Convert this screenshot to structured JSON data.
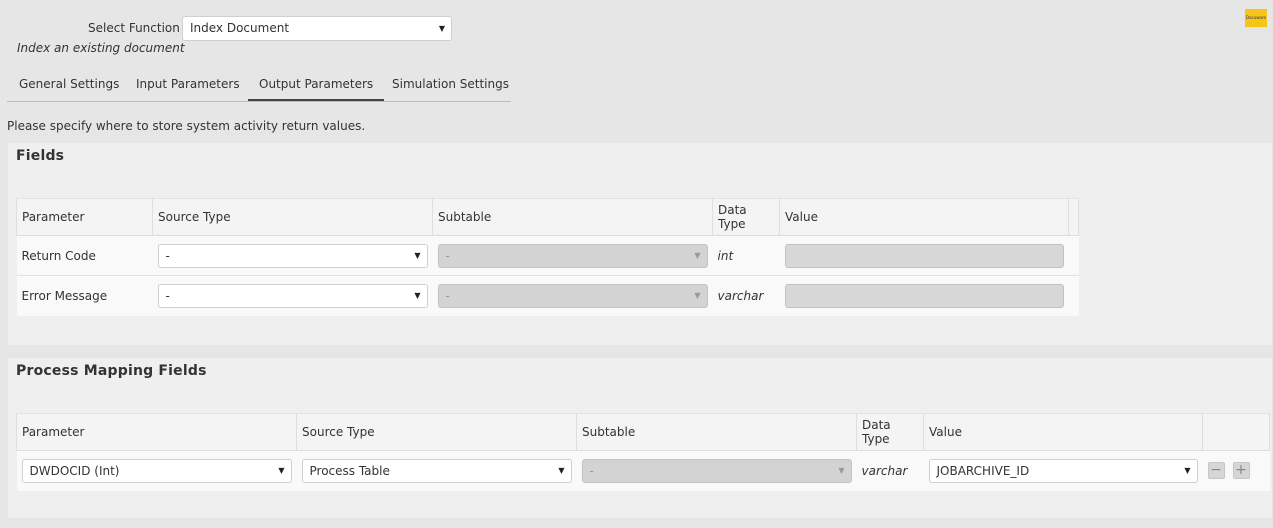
{
  "header": {
    "select_function_label": "Select Function",
    "function_value": "Index Document",
    "function_description": "Index an existing document",
    "logo_text": "Docuware"
  },
  "tabs": [
    {
      "label": "General Settings",
      "active": false
    },
    {
      "label": "Input Parameters",
      "active": false
    },
    {
      "label": "Output Parameters",
      "active": true
    },
    {
      "label": "Simulation Settings",
      "active": false
    }
  ],
  "instruction": "Please specify where to store system activity return values.",
  "fields_panel": {
    "title": "Fields",
    "columns": [
      "Parameter",
      "Source Type",
      "Subtable",
      "Data Type",
      "Value"
    ],
    "rows": [
      {
        "parameter": "Return Code",
        "source_type": "-",
        "subtable": "-",
        "data_type": "int",
        "value": ""
      },
      {
        "parameter": "Error Message",
        "source_type": "-",
        "subtable": "-",
        "data_type": "varchar",
        "value": ""
      }
    ]
  },
  "mapping_panel": {
    "title": "Process Mapping Fields",
    "columns": [
      "Parameter",
      "Source Type",
      "Subtable",
      "Data Type",
      "Value"
    ],
    "rows": [
      {
        "parameter": "DWDOCID (Int)",
        "source_type": "Process Table",
        "subtable": "-",
        "data_type": "varchar",
        "value": "JOBARCHIVE_ID"
      }
    ],
    "remove_label": "−",
    "add_label": "+"
  },
  "icons": {
    "dropdown": "caret-down-icon"
  }
}
